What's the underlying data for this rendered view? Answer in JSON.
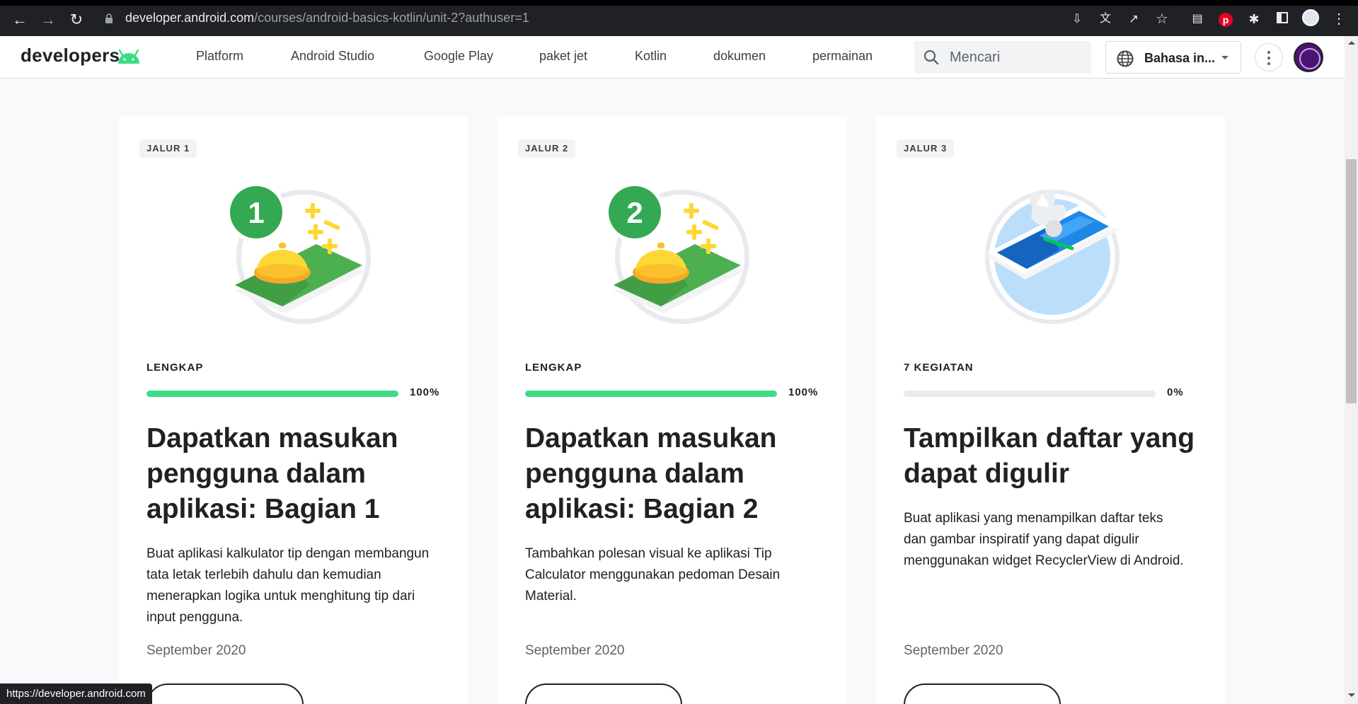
{
  "browser": {
    "url_host": "developer.android.com",
    "url_path": "/courses/android-basics-kotlin/unit-2?authuser=1",
    "status_url": "https://developer.android.com"
  },
  "header": {
    "logo_text": "developers",
    "nav": [
      "Platform",
      "Android Studio",
      "Google Play",
      "paket jet",
      "Kotlin",
      "dokumen",
      "permainan"
    ],
    "search_placeholder": "Mencari",
    "language_label": "Bahasa in..."
  },
  "cards": [
    {
      "badge": "JALUR 1",
      "number": "1",
      "status": "LENGKAP",
      "progress_percent": 100,
      "progress_label": "100%",
      "title": "Dapatkan masukan pengguna dalam aplikasi: Bagian 1",
      "description": "Buat aplikasi kalkulator tip dengan membangun tata letak terlebih dahulu dan kemudian menerapkan logika untuk menghitung tip dari input pengguna.",
      "date": "September 2020"
    },
    {
      "badge": "JALUR 2",
      "number": "2",
      "status": "LENGKAP",
      "progress_percent": 100,
      "progress_label": "100%",
      "title": "Dapatkan masukan pengguna dalam aplikasi: Bagian 2",
      "description": "Tambahkan polesan visual ke aplikasi Tip Calculator menggunakan pedoman Desain Material.",
      "date": "September 2020"
    },
    {
      "badge": "JALUR 3",
      "status": "7 KEGIATAN",
      "progress_percent": 0,
      "progress_label": "0%",
      "title": "Tampilkan daftar yang dapat digulir",
      "description": "Buat aplikasi yang menampilkan daftar teks dan gambar inspiratif yang dapat digulir menggunakan widget RecyclerView di Android.",
      "date": "September 2020"
    }
  ],
  "colors": {
    "progress_fill": "#3ddc84",
    "badge_green": "#34a853",
    "android_green": "#3ddc84"
  }
}
